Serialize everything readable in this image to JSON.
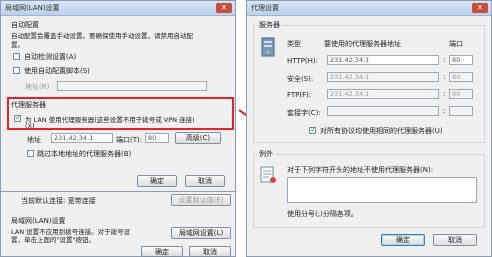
{
  "left_window": {
    "title": "局域网(LAN)设置",
    "auto_config": {
      "heading": "自动配置",
      "desc_line1": "自动配置会覆盖手动设置。要确保使用手动设置，请禁用自动配",
      "desc_line2": "置。",
      "auto_detect": "自动检测设置(A)",
      "use_script": "使用自动配置脚本(S)",
      "address_label": "地址(R)"
    },
    "proxy": {
      "heading": "代理服务器",
      "use_proxy_line1": "为 LAN 使用代理服务器(这些设置不用于拨号或 VPN 连接)",
      "use_proxy_line2": "(X)",
      "address_label": "地址",
      "address_value": "231.42.34.1",
      "port_label": "端口(T):",
      "port_value": "80",
      "advanced_button": "高级(C)",
      "bypass_local": "跳过本地地址的代理服务器(B)"
    },
    "ok_button": "确定",
    "cancel_button": "取消"
  },
  "behind_window": {
    "current_line": "当前默认连接: 宽带连接",
    "set_default_button": "设置默认值(E)",
    "lan_heading": "局域网(LAN)设置",
    "lan_desc_line1": "LAN 设置不应用到拨号连接。对于拨号设",
    "lan_desc_line2": "置，单击上面的\"设置\"按钮。",
    "lan_settings_button": "局域网设置(L)",
    "ok_button": "确定",
    "cancel_button": "取消"
  },
  "right_window": {
    "title": "代理设置",
    "servers": {
      "heading": "服务器",
      "col_type": "类型",
      "col_address": "要使用的代理服务器地址",
      "col_port": "端口",
      "rows": [
        {
          "label": "HTTP(H):",
          "address": "231.42.34.1",
          "port": "80"
        },
        {
          "label": "安全(S):",
          "address": "231.42.34.1",
          "port": "80"
        },
        {
          "label": "FTP(F):",
          "address": "231.42.34.1",
          "port": "80"
        },
        {
          "label": "套接字(C):",
          "address": "",
          "port": ""
        }
      ],
      "same_proxy": "对所有协议均使用相同的代理服务器(U)"
    },
    "exceptions": {
      "heading": "例外",
      "desc": "对于下列字符开头的地址不使用代理服务器(N):",
      "hint": "使用分号(;)分隔各项。"
    },
    "ok_button": "确定",
    "cancel_button": "取消"
  },
  "colors": {
    "highlight": "#e0242b",
    "arrow": "#e0242b"
  }
}
